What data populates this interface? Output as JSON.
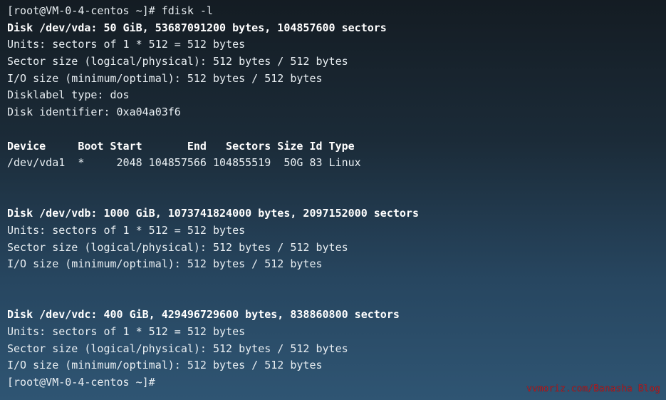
{
  "terminal": {
    "prompt1": "[root@VM-0-4-centos ~]# fdisk -l",
    "vda_header": "Disk /dev/vda: 50 GiB, 53687091200 bytes, 104857600 sectors",
    "vda_units": "Units: sectors of 1 * 512 = 512 bytes",
    "vda_sector": "Sector size (logical/physical): 512 bytes / 512 bytes",
    "vda_io": "I/O size (minimum/optimal): 512 bytes / 512 bytes",
    "vda_label": "Disklabel type: dos",
    "vda_ident": "Disk identifier: 0xa04a03f6",
    "partition_header": "Device     Boot Start       End   Sectors Size Id Type",
    "partition_row": "/dev/vda1  *     2048 104857566 104855519  50G 83 Linux",
    "vdb_header": "Disk /dev/vdb: 1000 GiB, 1073741824000 bytes, 2097152000 sectors",
    "vdb_units": "Units: sectors of 1 * 512 = 512 bytes",
    "vdb_sector": "Sector size (logical/physical): 512 bytes / 512 bytes",
    "vdb_io": "I/O size (minimum/optimal): 512 bytes / 512 bytes",
    "vdc_header": "Disk /dev/vdc: 400 GiB, 429496729600 bytes, 838860800 sectors",
    "vdc_units": "Units: sectors of 1 * 512 = 512 bytes",
    "vdc_sector": "Sector size (logical/physical): 512 bytes / 512 bytes",
    "vdc_io": "I/O size (minimum/optimal): 512 bytes / 512 bytes",
    "prompt2": "[root@VM-0-4-centos ~]#"
  },
  "watermark": "vvmoriz.com/Banasha Blog",
  "colors": {
    "text": "#e8eef2",
    "bold_text": "#ffffff",
    "watermark": "#b61d22"
  }
}
